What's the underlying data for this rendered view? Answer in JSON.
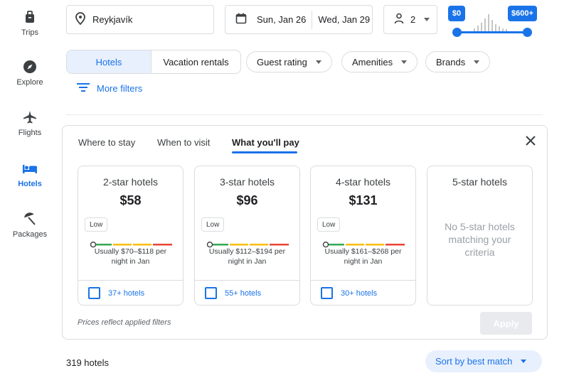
{
  "nav": {
    "items": [
      {
        "label": "Trips",
        "icon": "luggage-icon"
      },
      {
        "label": "Explore",
        "icon": "compass-icon"
      },
      {
        "label": "Flights",
        "icon": "airplane-icon"
      },
      {
        "label": "Hotels",
        "icon": "bed-icon",
        "active": true
      },
      {
        "label": "Packages",
        "icon": "beach-umbrella-icon"
      }
    ]
  },
  "search": {
    "location": "Reykjavík",
    "check_in": "Sun, Jan 26",
    "check_out": "Wed, Jan 29",
    "guests": "2"
  },
  "price_slider": {
    "min_label": "$0",
    "max_label": "$600+"
  },
  "filters": {
    "segment_hotels": "Hotels",
    "segment_rentals": "Vacation rentals",
    "guest_rating": "Guest rating",
    "amenities": "Amenities",
    "brands": "Brands",
    "more_filters": "More filters"
  },
  "panel": {
    "tabs": [
      "Where to stay",
      "When to visit",
      "What you'll pay"
    ],
    "active_tab": 2,
    "cards": [
      {
        "title": "2-star hotels",
        "price": "$58",
        "low": "Low",
        "range": "Usually $70–$118 per night in Jan",
        "count": "37+ hotels"
      },
      {
        "title": "3-star hotels",
        "price": "$96",
        "low": "Low",
        "range": "Usually $112–$194 per night in Jan",
        "count": "55+ hotels"
      },
      {
        "title": "4-star hotels",
        "price": "$131",
        "low": "Low",
        "range": "Usually $161–$268 per night in Jan",
        "count": "30+ hotels"
      }
    ],
    "empty_card": {
      "title": "5-star hotels",
      "message": "No 5-star hotels matching your criteria"
    },
    "note": "Prices reflect applied filters",
    "apply": "Apply"
  },
  "results": {
    "count": "319 hotels",
    "sort": "Sort by best match"
  },
  "colors": {
    "accent": "#1a73e8",
    "level_low": "#34a853",
    "level_mid": "#fbbc04",
    "level_high": "#ea4335"
  }
}
